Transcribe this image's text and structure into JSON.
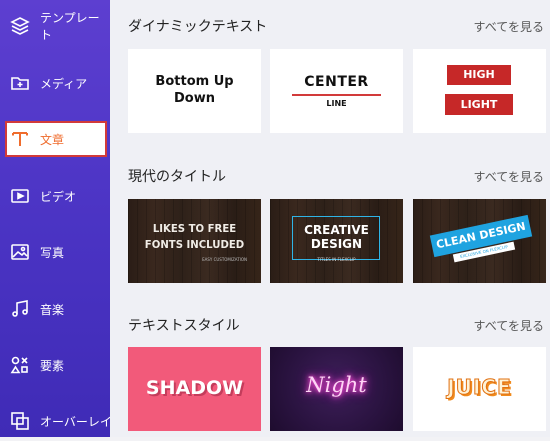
{
  "sidebar": {
    "items": [
      {
        "label": "テンプレート",
        "icon": "layers-icon"
      },
      {
        "label": "メディア",
        "icon": "folder-plus-icon"
      },
      {
        "label": "文章",
        "icon": "text-icon"
      },
      {
        "label": "ビデオ",
        "icon": "video-icon"
      },
      {
        "label": "写真",
        "icon": "image-icon"
      },
      {
        "label": "音楽",
        "icon": "music-icon"
      },
      {
        "label": "要素",
        "icon": "elements-icon"
      },
      {
        "label": "オーバーレイ",
        "icon": "overlay-icon"
      }
    ],
    "active_color": "#ef6c2d"
  },
  "sections": [
    {
      "title": "ダイナミックテキスト",
      "see_all": "すべてを見る",
      "cards": [
        {
          "text": [
            "Bottom Up",
            "Down"
          ]
        },
        {
          "text": [
            "CENTER",
            "LINE"
          ]
        },
        {
          "text": [
            "HIGH",
            "LIGHT"
          ]
        }
      ]
    },
    {
      "title": "現代のタイトル",
      "see_all": "すべてを見る",
      "cards": [
        {
          "text": [
            "LIKES TO FREE",
            "FONTS INCLUDED",
            "EASY CUSTOMIZATION"
          ]
        },
        {
          "text": [
            "CREATIVE",
            "DESIGN",
            "TITLES IN FLEXCLIP"
          ]
        },
        {
          "text": [
            "CLEAN DESIGN",
            "EXCLUSIVE ON FLEXCLIP"
          ]
        }
      ]
    },
    {
      "title": "テキストスタイル",
      "see_all": "すべてを見る",
      "cards": [
        {
          "text": [
            "SHADOW"
          ]
        },
        {
          "text": [
            "Night"
          ]
        },
        {
          "text": [
            "JUICE"
          ]
        }
      ]
    }
  ],
  "colors": {
    "sidebar_bg": "#4b34c4",
    "highlight_red": "#c62828",
    "clean_design_blue": "#1fa3e0",
    "shadow_pink": "#f25a7a",
    "night_bg": "#2a1340",
    "night_pink": "#ff4fd8",
    "juice_orange": "#f08a1c"
  }
}
